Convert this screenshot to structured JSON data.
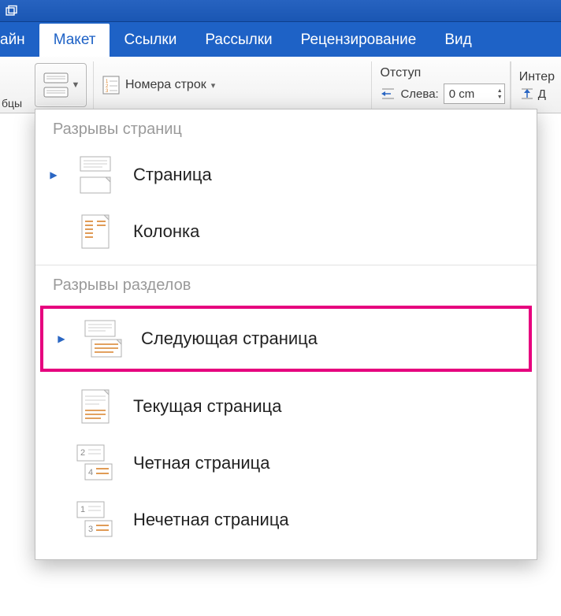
{
  "tabs": {
    "partial_left": "айн",
    "active": "Макет",
    "links": "Ссылки",
    "mailings": "Рассылки",
    "review": "Рецензирование",
    "view_partial": "Вид"
  },
  "ribbon": {
    "line_numbers": "Номера строк",
    "columns_partial": "бцы",
    "indent": {
      "header": "Отступ",
      "left_label": "Слева:",
      "left_value": "0 cm"
    },
    "spacing": {
      "header_partial": "Интер",
      "before_partial": "Д"
    }
  },
  "dropdown": {
    "section1_title": "Разрывы страниц",
    "item_page": "Страница",
    "item_column": "Колонка",
    "section2_title": "Разрывы разделов",
    "item_next_page": "Следующая страница",
    "item_current_page": "Текущая страница",
    "item_even_page": "Четная страница",
    "item_odd_page": "Нечетная страница"
  }
}
